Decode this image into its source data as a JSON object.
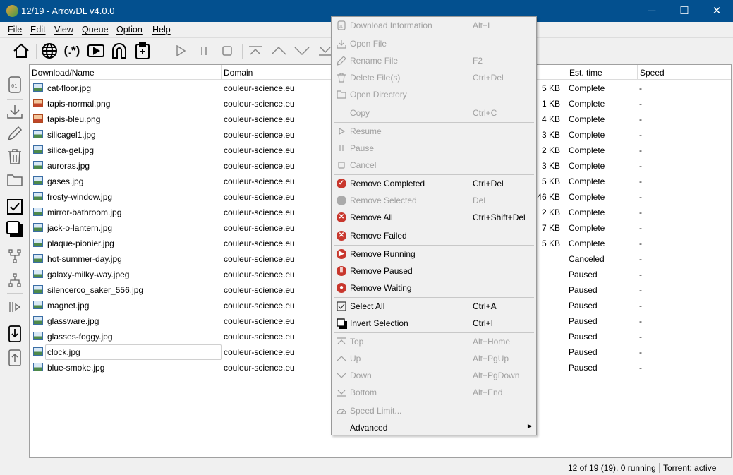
{
  "window": {
    "title": "12/19 - ArrowDL v4.0.0",
    "minimize": "─",
    "maximize": "☐",
    "close": "✕"
  },
  "menubar": [
    "File",
    "Edit",
    "View",
    "Queue",
    "Option",
    "Help"
  ],
  "table": {
    "headers": [
      "Download/Name",
      "Domain",
      "Est. time",
      "Speed"
    ],
    "rows": [
      {
        "name": "cat-floor.jpg",
        "type": "jpg",
        "domain": "couleur-science.eu",
        "size": "5 KB",
        "est": "Complete",
        "speed": "-"
      },
      {
        "name": "tapis-normal.png",
        "type": "png",
        "domain": "couleur-science.eu",
        "size": "1 KB",
        "est": "Complete",
        "speed": "-"
      },
      {
        "name": "tapis-bleu.png",
        "type": "png",
        "domain": "couleur-science.eu",
        "size": "4 KB",
        "est": "Complete",
        "speed": "-"
      },
      {
        "name": "silicagel1.jpg",
        "type": "jpg",
        "domain": "couleur-science.eu",
        "size": "3 KB",
        "est": "Complete",
        "speed": "-"
      },
      {
        "name": "silica-gel.jpg",
        "type": "jpg",
        "domain": "couleur-science.eu",
        "size": "2 KB",
        "est": "Complete",
        "speed": "-"
      },
      {
        "name": "auroras.jpg",
        "type": "jpg",
        "domain": "couleur-science.eu",
        "size": "3 KB",
        "est": "Complete",
        "speed": "-"
      },
      {
        "name": "gases.jpg",
        "type": "jpg",
        "domain": "couleur-science.eu",
        "size": "5 KB",
        "est": "Complete",
        "speed": "-"
      },
      {
        "name": "frosty-window.jpg",
        "type": "jpg",
        "domain": "couleur-science.eu",
        "size": "146 KB",
        "est": "Complete",
        "speed": "-"
      },
      {
        "name": "mirror-bathroom.jpg",
        "type": "jpg",
        "domain": "couleur-science.eu",
        "size": "2 KB",
        "est": "Complete",
        "speed": "-"
      },
      {
        "name": "jack-o-lantern.jpg",
        "type": "jpg",
        "domain": "couleur-science.eu",
        "size": "7 KB",
        "est": "Complete",
        "speed": "-"
      },
      {
        "name": "plaque-pionier.jpg",
        "type": "jpg",
        "domain": "couleur-science.eu",
        "size": "5 KB",
        "est": "Complete",
        "speed": "-"
      },
      {
        "name": "hot-summer-day.jpg",
        "type": "jpg",
        "domain": "couleur-science.eu",
        "size": "",
        "est": "Canceled",
        "speed": "-"
      },
      {
        "name": "galaxy-milky-way.jpeg",
        "type": "jpg",
        "domain": "couleur-science.eu",
        "size": "",
        "est": "Paused",
        "speed": "-"
      },
      {
        "name": "silencerco_saker_556.jpg",
        "type": "jpg",
        "domain": "couleur-science.eu",
        "size": "",
        "est": "Paused",
        "speed": "-"
      },
      {
        "name": "magnet.jpg",
        "type": "jpg",
        "domain": "couleur-science.eu",
        "size": "",
        "est": "Paused",
        "speed": "-"
      },
      {
        "name": "glassware.jpg",
        "type": "jpg",
        "domain": "couleur-science.eu",
        "size": "",
        "est": "Paused",
        "speed": "-"
      },
      {
        "name": "glasses-foggy.jpg",
        "type": "jpg",
        "domain": "couleur-science.eu",
        "size": "",
        "est": "Paused",
        "speed": "-"
      },
      {
        "name": "clock.jpg",
        "type": "jpg",
        "domain": "couleur-science.eu",
        "size": "",
        "est": "Paused",
        "speed": "-",
        "focused": true
      },
      {
        "name": "blue-smoke.jpg",
        "type": "jpg",
        "domain": "couleur-science.eu",
        "size": "",
        "est": "Paused",
        "speed": "-"
      }
    ]
  },
  "status": {
    "summary": "12 of 19 (19), 0 running",
    "torrent": "Torrent: active"
  },
  "context_menu": [
    {
      "label": "Download Information",
      "shortcut": "Alt+I",
      "icon": "info-01-icon",
      "disabled": true,
      "sep_after": true
    },
    {
      "label": "Open File",
      "icon": "download-arrow-icon",
      "disabled": true
    },
    {
      "label": "Rename File",
      "shortcut": "F2",
      "icon": "pencil-icon",
      "disabled": true
    },
    {
      "label": "Delete File(s)",
      "shortcut": "Ctrl+Del",
      "icon": "trash-icon",
      "disabled": true
    },
    {
      "label": "Open Directory",
      "icon": "folder-icon",
      "disabled": true,
      "sep_after": true
    },
    {
      "label": "Copy",
      "shortcut": "Ctrl+C",
      "disabled": true,
      "sep_after": true
    },
    {
      "label": "Resume",
      "icon": "play-icon",
      "disabled": true
    },
    {
      "label": "Pause",
      "icon": "pause-icon",
      "disabled": true
    },
    {
      "label": "Cancel",
      "icon": "stop-icon",
      "disabled": true,
      "sep_after": true
    },
    {
      "label": "Remove Completed",
      "shortcut": "Ctrl+Del",
      "icon": "check-circle-icon"
    },
    {
      "label": "Remove Selected",
      "shortcut": "Del",
      "icon": "minus-circle-icon",
      "disabled": true
    },
    {
      "label": "Remove All",
      "shortcut": "Ctrl+Shift+Del",
      "icon": "x-circle-icon",
      "sep_after": true
    },
    {
      "label": "Remove Failed",
      "icon": "x-circle-icon",
      "sep_after": true
    },
    {
      "label": "Remove Running",
      "icon": "play-circle-icon"
    },
    {
      "label": "Remove Paused",
      "icon": "pause-circle-icon"
    },
    {
      "label": "Remove Waiting",
      "icon": "dot-circle-icon",
      "sep_after": true
    },
    {
      "label": "Select All",
      "shortcut": "Ctrl+A",
      "icon": "checkbox-icon"
    },
    {
      "label": "Invert Selection",
      "shortcut": "Ctrl+I",
      "icon": "invert-icon",
      "sep_after": true
    },
    {
      "label": "Top",
      "shortcut": "Alt+Home",
      "icon": "top-icon",
      "disabled": true
    },
    {
      "label": "Up",
      "shortcut": "Alt+PgUp",
      "icon": "up-icon",
      "disabled": true
    },
    {
      "label": "Down",
      "shortcut": "Alt+PgDown",
      "icon": "down-icon",
      "disabled": true
    },
    {
      "label": "Bottom",
      "shortcut": "Alt+End",
      "icon": "bottom-icon",
      "disabled": true,
      "sep_after": true
    },
    {
      "label": "Speed Limit...",
      "icon": "gauge-icon",
      "disabled": true
    },
    {
      "label": "Advanced",
      "submenu": true
    }
  ],
  "colors": {
    "titlebar": "#03508f",
    "remove_icon": "#c8372d"
  }
}
